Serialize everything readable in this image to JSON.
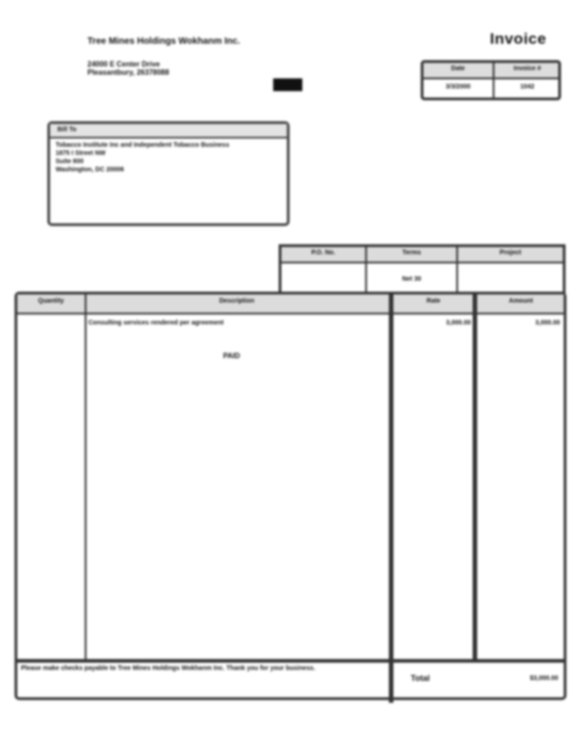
{
  "header": {
    "company_name": "Tree Mines Holdings Wokhanm Inc.",
    "address_line1": "24000 E Center Drive",
    "address_line2": "Pleasantbury, 26378088",
    "title": "Invoice"
  },
  "meta": {
    "columns": [
      "Date",
      "Invoice #"
    ],
    "values": [
      "3/3/2000",
      "1042"
    ]
  },
  "bill_to": {
    "label": "Bill To",
    "lines": [
      "Tobacco Institute Inc and Independent Tobacco Business",
      "1875 I Street NW",
      "Suite 800",
      "Washington, DC 20006"
    ]
  },
  "terms": {
    "columns": [
      "P.O. No.",
      "Terms",
      "Project"
    ],
    "values": [
      "",
      "Net 30",
      ""
    ]
  },
  "items": {
    "columns": [
      "Quantity",
      "Description",
      "Rate",
      "Amount"
    ],
    "rows": [
      {
        "quantity": "",
        "description": "Consulting services rendered per agreement",
        "rate": "3,000.00",
        "amount": "3,000.00"
      }
    ],
    "stamp": "PAID",
    "footer_note": "Please make checks payable to Tree Mines Holdings Wokhanm Inc. Thank you for your business.",
    "total_label": "Total",
    "total_value": "$3,000.00"
  }
}
